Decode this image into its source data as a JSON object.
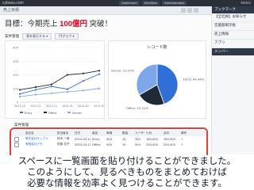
{
  "browser": {
    "brand": "cybozu.com",
    "tabs": [
      "Dashboard",
      "Workflow",
      "Administration"
    ],
    "user": "Admin"
  },
  "header": {
    "breadcrumb": "売上目標"
  },
  "main": {
    "goal_prefix": "目標：今期売上 ",
    "goal_amount": "100億円",
    "goal_suffix": " 突破！",
    "panel_title": "案件管理",
    "panel_buttons": [
      "表を表示する ▾",
      "円グラフ ▾"
    ],
    "pie_title": "レコード数"
  },
  "chart_data": [
    {
      "type": "line",
      "title": "",
      "x": [
        "2013-10",
        "2013-11",
        "2013-12",
        "2014-01",
        "2014-02",
        "2014-03"
      ],
      "series": [
        {
          "name": "Entry",
          "values": [
            60,
            90,
            115,
            95,
            155,
            205
          ]
        },
        {
          "name": "Office",
          "values": [
            90,
            110,
            130,
            200,
            210,
            230
          ]
        },
        {
          "name": "Server",
          "values": [
            40,
            55,
            65,
            75,
            85,
            100
          ]
        }
      ],
      "ylim": [
        0,
        400
      ],
      "ylabel": "",
      "xlabel": "",
      "legend": "bottom"
    },
    {
      "type": "pie",
      "title": "レコード数",
      "labels": [
        "Entry: 44.44%",
        "Office: 22.22%",
        "Server: 33.33%"
      ],
      "values": [
        44.44,
        22.22,
        33.33
      ],
      "colors": [
        "#2f6fd6",
        "#1f2a36",
        "#7da7ea"
      ],
      "legend": "right"
    }
  ],
  "table": {
    "title": "案件管理",
    "headers": [
      "",
      "会社名",
      "担当者名",
      "日付",
      "製品",
      "単価",
      "数量",
      "ユーザー数",
      "小計",
      "合計",
      "操作"
    ],
    "rows": [
      [
        "",
        "株式会社サンプル",
        "鈴木 一郎",
        "2014-03-10",
        "Entry",
        "300",
        "10",
        "300",
        "180,000",
        "180,000",
        "✎"
      ],
      [
        "",
        "有限会社デモ",
        "佐藤 花子",
        "2014-03-12",
        "Office",
        "500",
        "10",
        "500",
        "250,000",
        "250,000",
        "✎"
      ]
    ]
  },
  "sidebar": {
    "section": "ブックマーク",
    "items": [
      "【全社員】お知らせ",
      "営業部掲示板",
      "売上情報",
      "アプリ"
    ],
    "section2": "メンバー"
  },
  "caption": {
    "line1": "スペースに一覧画面を貼り付けることができました。",
    "line2": "このようにして、見るべきものをまとめておけば",
    "line3": "必要な情報を効率よく見つけることができます。"
  }
}
